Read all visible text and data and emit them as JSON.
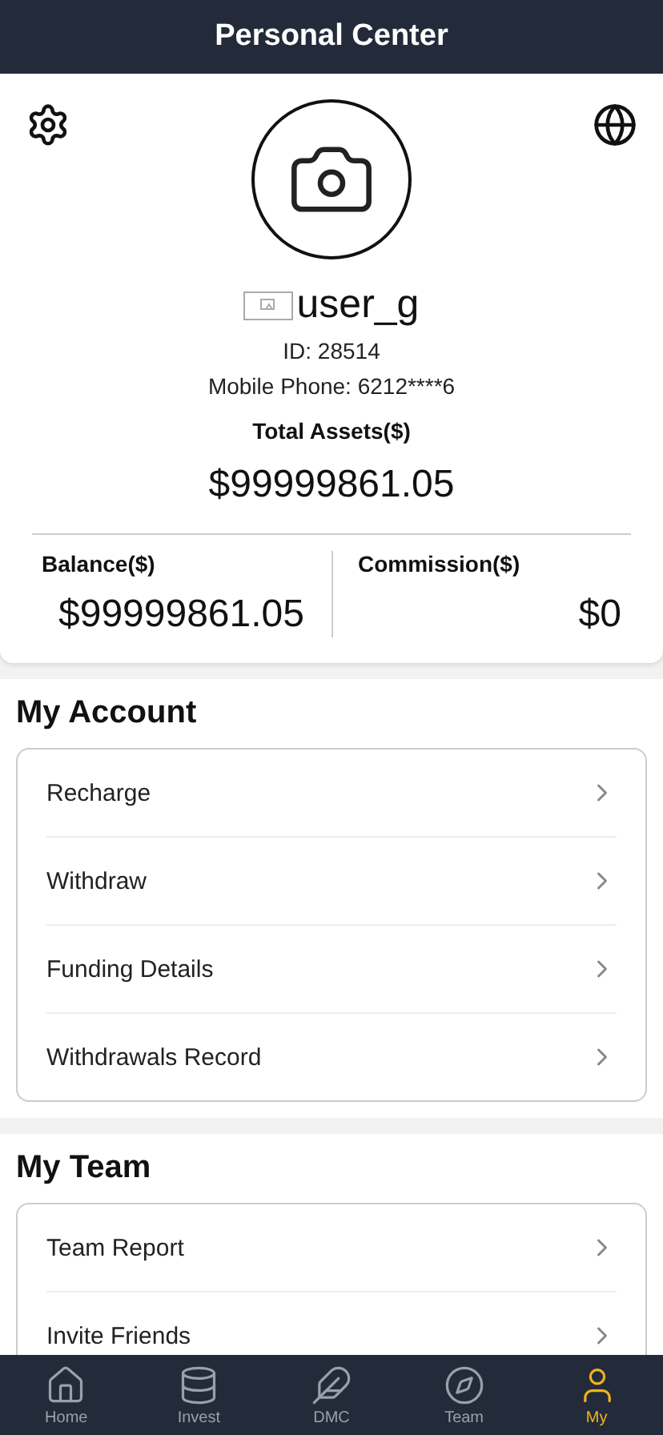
{
  "header": {
    "title": "Personal Center"
  },
  "profile": {
    "username": "user_g",
    "id": "ID: 28514",
    "phone": "Mobile Phone: 6212****6",
    "total_label": "Total Assets($)",
    "total_value": "$99999861.05",
    "balance_label": "Balance($)",
    "balance_value": "$99999861.05",
    "commission_label": "Commission($)",
    "commission_value": "$0"
  },
  "sections": [
    {
      "title": "My Account",
      "items": [
        "Recharge",
        "Withdraw",
        "Funding Details",
        "Withdrawals Record"
      ]
    },
    {
      "title": "My Team",
      "items": [
        "Team Report",
        "Invite Friends"
      ]
    }
  ],
  "tabs": [
    {
      "label": "Home",
      "selected": false
    },
    {
      "label": "Invest",
      "selected": false
    },
    {
      "label": "DMC",
      "selected": false
    },
    {
      "label": "Team",
      "selected": false
    },
    {
      "label": "My",
      "selected": true
    }
  ]
}
